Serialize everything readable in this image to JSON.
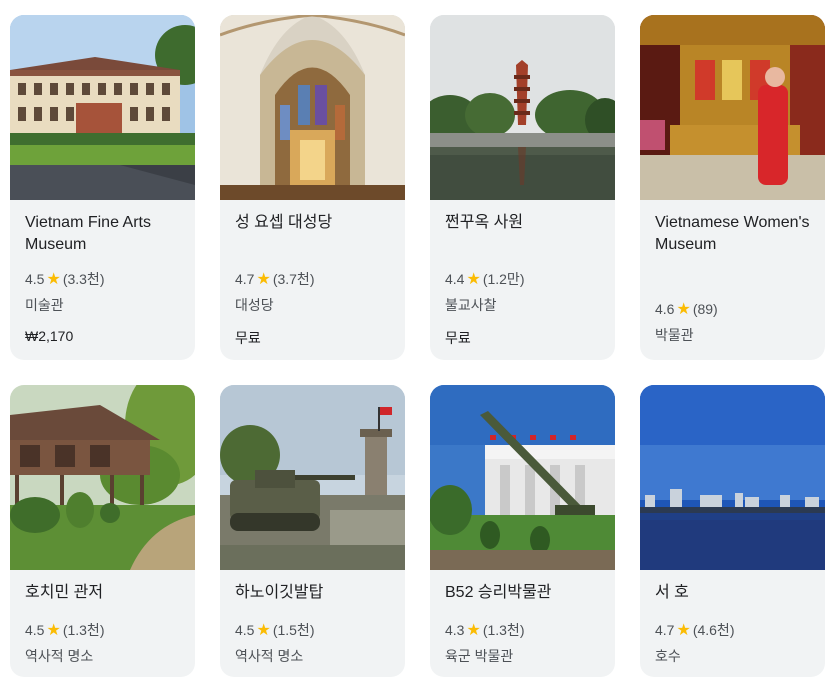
{
  "colors": {
    "card_bg": "#f1f3f4",
    "star": "#fbbc04",
    "title": "#202124",
    "meta": "#4d5156"
  },
  "cards": [
    {
      "title": "Vietnam Fine Arts Museum",
      "rating": "4.5",
      "reviews": "(3.3천)",
      "category": "미술관",
      "price": "₩2,170",
      "star_icon": "star-icon"
    },
    {
      "title": "성 요셉 대성당",
      "rating": "4.7",
      "reviews": "(3.7천)",
      "category": "대성당",
      "price": "무료",
      "star_icon": "star-icon"
    },
    {
      "title": "쩐꾸옥 사원",
      "rating": "4.4",
      "reviews": "(1.2만)",
      "category": "불교사찰",
      "price": "무료",
      "star_icon": "star-icon"
    },
    {
      "title": "Vietnamese Women's Museum",
      "rating": "4.6",
      "reviews": "(89)",
      "category": "박물관",
      "price": "",
      "star_icon": "star-icon"
    },
    {
      "title": "호치민 관저",
      "rating": "4.5",
      "reviews": "(1.3천)",
      "category": "역사적 명소",
      "price": "",
      "star_icon": "star-icon"
    },
    {
      "title": "하노이깃발탑",
      "rating": "4.5",
      "reviews": "(1.5천)",
      "category": "역사적 명소",
      "price": "",
      "star_icon": "star-icon"
    },
    {
      "title": "B52 승리박물관",
      "rating": "4.3",
      "reviews": "(1.3천)",
      "category": "육군 박물관",
      "price": "",
      "star_icon": "star-icon"
    },
    {
      "title": "서 호",
      "rating": "4.7",
      "reviews": "(4.6천)",
      "category": "호수",
      "price": "",
      "star_icon": "star-icon"
    }
  ]
}
